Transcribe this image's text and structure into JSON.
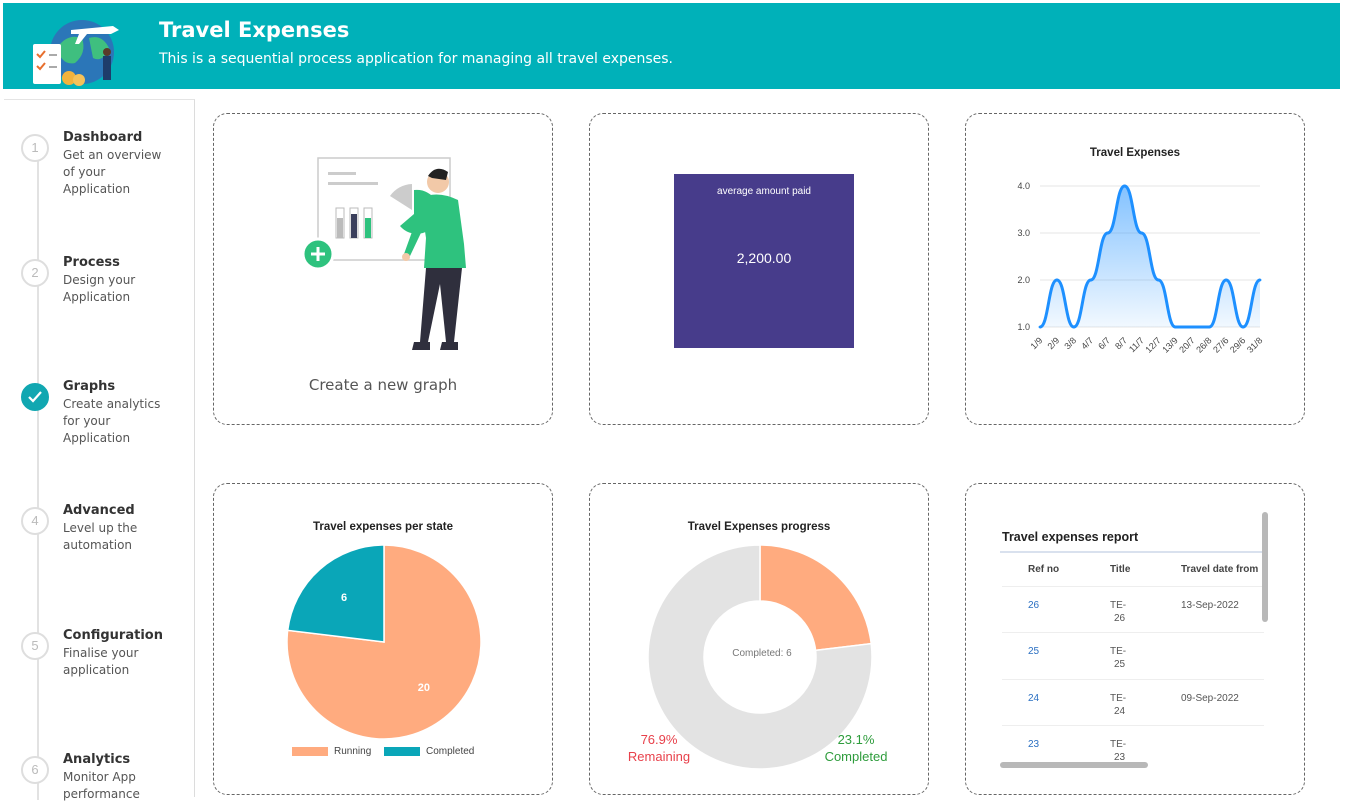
{
  "header": {
    "title": "Travel Expenses",
    "subtitle": "This is a sequential process application for managing all travel expenses."
  },
  "steps": [
    {
      "num": "1",
      "title": "Dashboard",
      "desc": "Get an overview of your Application",
      "done": false
    },
    {
      "num": "2",
      "title": "Process",
      "desc": "Design your Application",
      "done": false
    },
    {
      "num": "3",
      "title": "Graphs",
      "desc": "Create analytics for your Application",
      "done": true
    },
    {
      "num": "4",
      "title": "Advanced",
      "desc": "Level up the automation",
      "done": false
    },
    {
      "num": "5",
      "title": "Configuration",
      "desc": "Finalise your application",
      "done": false
    },
    {
      "num": "6",
      "title": "Analytics",
      "desc": "Monitor App performance",
      "done": false
    }
  ],
  "new_graph": {
    "label": "Create a new graph"
  },
  "kpi": {
    "label": "average amount paid",
    "value": "2,200.00",
    "color": "#473c8b"
  },
  "colors": {
    "header": "#00b1b9",
    "accent": "#11a7b1",
    "running": "#ffab7f",
    "completed": "#0aa6b8",
    "line": "#1e90ff"
  },
  "chart_data": [
    {
      "type": "area",
      "title": "Travel Expenses",
      "categories": [
        "1/9",
        "2/9",
        "3/8",
        "4/7",
        "6/7",
        "8/7",
        "11/7",
        "12/7",
        "13/9",
        "20/7",
        "26/8",
        "27/6",
        "29/6",
        "31/8"
      ],
      "y_tick_labels": [
        "1.0",
        "2.0",
        "3.0",
        "4.0"
      ],
      "series": [
        {
          "values": [
            1,
            2,
            1,
            2,
            3,
            4,
            3,
            2,
            1,
            1,
            1,
            2,
            1,
            2
          ]
        }
      ],
      "ylim": [
        1,
        4
      ],
      "grid": true
    },
    {
      "type": "pie",
      "title": "Travel expenses per state",
      "labels": [
        "Running",
        "Completed"
      ],
      "values": [
        20,
        6
      ],
      "legend": "bottom"
    },
    {
      "type": "pie",
      "title": "Travel Expenses progress",
      "labels": [
        "Remaining",
        "Completed"
      ],
      "values": [
        76.9,
        23.1
      ],
      "center_label": "Completed: 6",
      "remaining_pct": "76.9%",
      "remaining_label": "Remaining",
      "completed_pct": "23.1%",
      "completed_label": "Completed"
    },
    {
      "type": "table",
      "title": "Travel expenses report",
      "columns": [
        "Ref no",
        "Title",
        "Travel date from"
      ],
      "rows": [
        {
          "ref": "26",
          "title1": "TE-",
          "title2": "26",
          "date": "13-Sep-2022"
        },
        {
          "ref": "25",
          "title1": "TE-",
          "title2": "25",
          "date": ""
        },
        {
          "ref": "24",
          "title1": "TE-",
          "title2": "24",
          "date": "09-Sep-2022"
        },
        {
          "ref": "23",
          "title1": "TE-",
          "title2": "23",
          "date": ""
        }
      ]
    }
  ]
}
